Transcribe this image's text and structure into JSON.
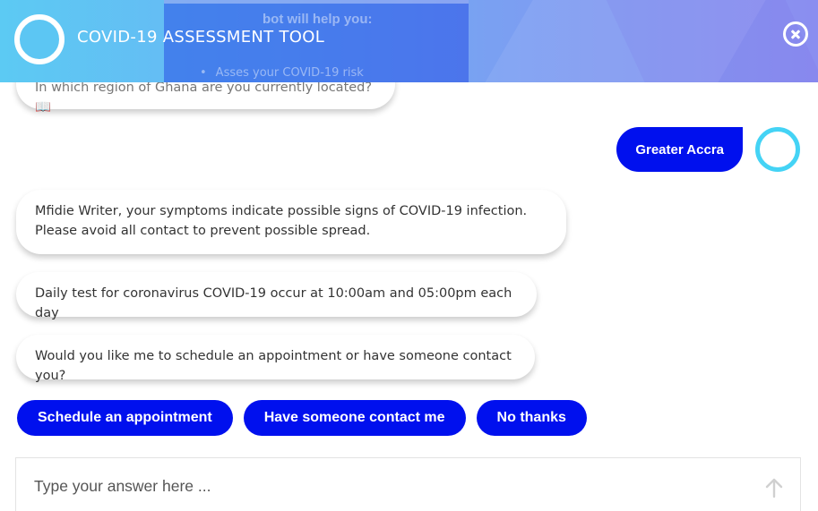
{
  "header": {
    "title": "COVID-19 ASSESSMENT TOOL",
    "ghost_title": "bot will help you:",
    "ghost_item": "Asses your COVID-19 risk"
  },
  "messages": {
    "region_question": "In which region of Ghana are you currently located? 📖",
    "user_reply": "Greater Accra",
    "symptoms": "Mfidie Writer, your symptoms indicate possible signs of COVID-19 infection.\nPlease avoid all contact to prevent possible spread.",
    "daily_test": "Daily test for coronavirus COVID-19 occur at 10:00am and 05:00pm each day",
    "schedule_question": "Would you like me to schedule an appointment or have someone contact you?"
  },
  "quick_replies": [
    {
      "label": "Schedule an appointment"
    },
    {
      "label": "Have someone contact me"
    },
    {
      "label": "No thanks"
    }
  ],
  "input": {
    "placeholder": "Type your answer here ..."
  },
  "colors": {
    "accent": "#0010ee",
    "avatar_ring": "#44d3f5"
  }
}
